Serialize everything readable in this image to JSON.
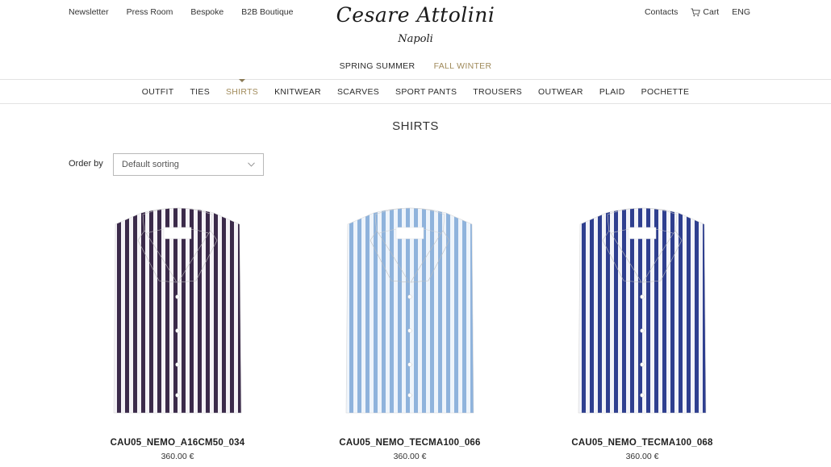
{
  "header": {
    "util_left": [
      "Newsletter",
      "Press Room",
      "Bespoke",
      "B2B Boutique"
    ],
    "contacts": "Contacts",
    "cart": "Cart",
    "language": "ENG",
    "cart_icon": "cart-icon"
  },
  "logo": {
    "brand": "Cesare Attolini",
    "city": "Napoli"
  },
  "seasons": {
    "spring": "SPRING SUMMER",
    "fall": "FALL WINTER"
  },
  "nav": {
    "tabs": [
      "OUTFIT",
      "TIES",
      "SHIRTS",
      "KNITWEAR",
      "SCARVES",
      "SPORT PANTS",
      "TROUSERS",
      "OUTWEAR",
      "PLAID",
      "POCHETTE"
    ],
    "active": "SHIRTS"
  },
  "page": {
    "title": "SHIRTS"
  },
  "sort": {
    "label": "Order by",
    "selected": "Default sorting",
    "icon": "chevron-down-icon"
  },
  "products": [
    {
      "code": "CAU05_NEMO_A16CM50_034",
      "price": "360.00 €",
      "stripe_color": "#3b2a4a",
      "base_color": "#f4f2f6"
    },
    {
      "code": "CAU05_NEMO_TECMA100_066",
      "price": "360.00 €",
      "stripe_color": "#8fb3dc",
      "base_color": "#eef4fb"
    },
    {
      "code": "CAU05_NEMO_TECMA100_068",
      "price": "360.00 €",
      "stripe_color": "#2f3f8f",
      "base_color": "#f2f3f8"
    }
  ],
  "colors": {
    "accent": "#a08a5a",
    "border": "#e3e3e3"
  }
}
